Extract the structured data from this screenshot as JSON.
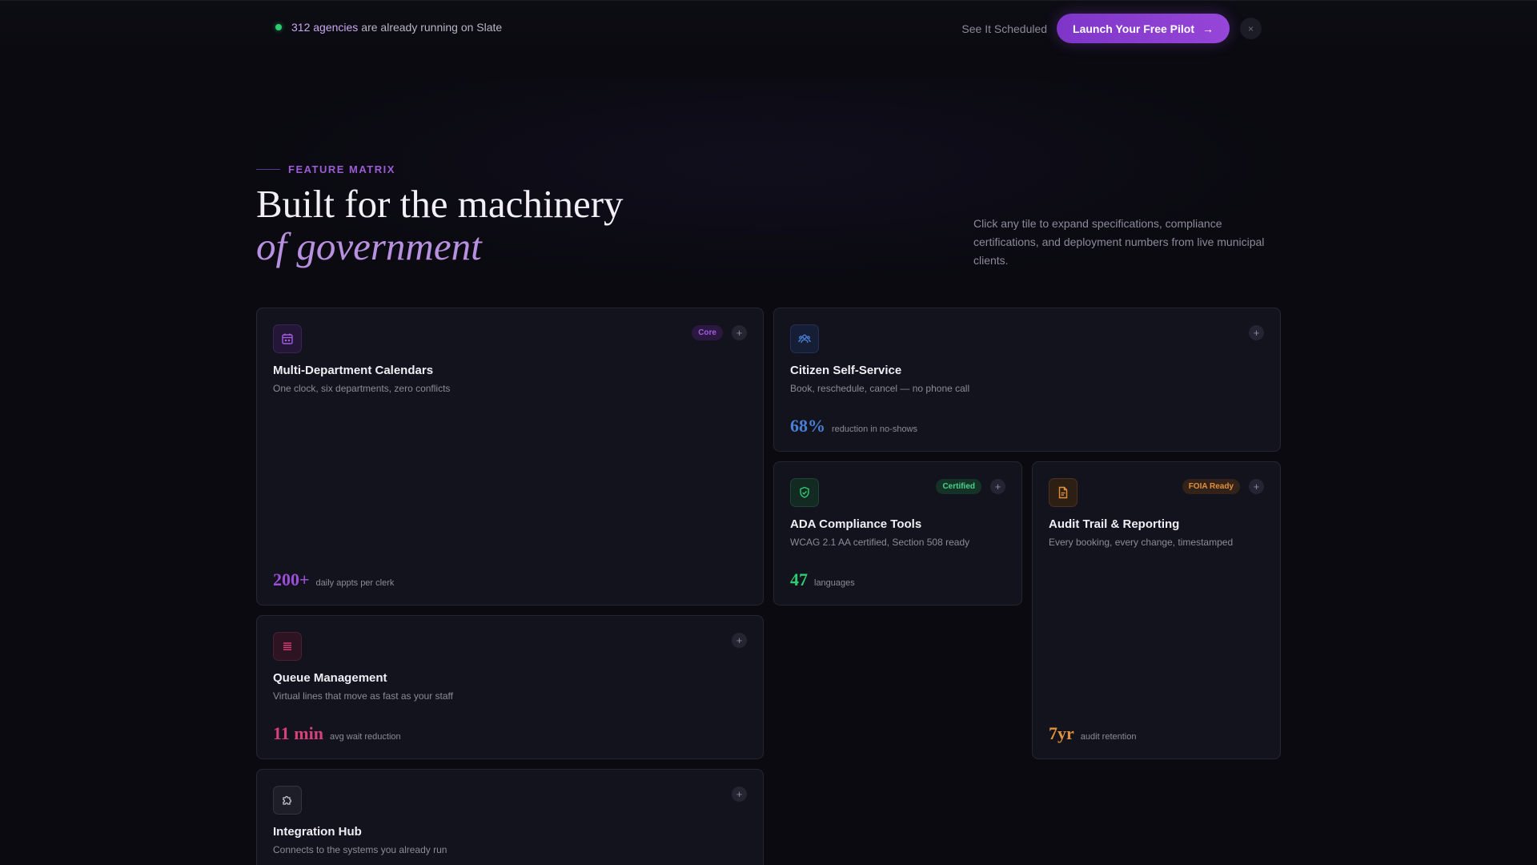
{
  "topbar": {
    "agency_count": "312 agencies",
    "status_text": "are already running on Slate",
    "secondary_link": "See It Scheduled",
    "cta_label": "Launch Your Free Pilot",
    "cta_arrow": "→",
    "close_glyph": "×"
  },
  "header": {
    "eyebrow": "FEATURE MATRIX",
    "title_line1": "Built for the machinery",
    "title_line2": "of government",
    "intro": "Click any tile to expand specifications, compliance certifications, and deployment numbers from live municipal clients."
  },
  "colors": {
    "purple": "#9b4fd6",
    "blue": "#4a7fd6",
    "green": "#2ecc71",
    "orange": "#e0903a",
    "pink": "#d8407a",
    "neutral": "#b9b6c4"
  },
  "cards": [
    {
      "title": "Multi-Department Calendars",
      "subtitle": "One clock, six departments, zero conflicts",
      "badge": "Core",
      "stat_value": "200+",
      "stat_label": "daily appts per clerk",
      "icon": "calendar-icon",
      "plus": "+"
    },
    {
      "title": "Citizen Self-Service",
      "subtitle": "Book, reschedule, cancel — no phone call",
      "badge": "",
      "stat_value": "68%",
      "stat_label": "reduction in no-shows",
      "icon": "users-icon",
      "plus": "+"
    },
    {
      "title": "ADA Compliance Tools",
      "subtitle": "WCAG 2.1 AA certified, Section 508 ready",
      "badge": "Certified",
      "stat_value": "47",
      "stat_label": "languages",
      "icon": "shield-check-icon",
      "plus": "+"
    },
    {
      "title": "Audit Trail & Reporting",
      "subtitle": "Every booking, every change, timestamped",
      "badge": "FOIA Ready",
      "stat_value": "7yr",
      "stat_label": "audit retention",
      "icon": "document-icon",
      "plus": "+"
    },
    {
      "title": "Queue Management",
      "subtitle": "Virtual lines that move as fast as your staff",
      "badge": "",
      "stat_value": "11 min",
      "stat_label": "avg wait reduction",
      "icon": "list-icon",
      "plus": "+"
    },
    {
      "title": "Integration Hub",
      "subtitle": "Connects to the systems you already run",
      "badge": "",
      "stat_value": "",
      "stat_label": "",
      "icon": "puzzle-icon",
      "plus": "+"
    }
  ]
}
